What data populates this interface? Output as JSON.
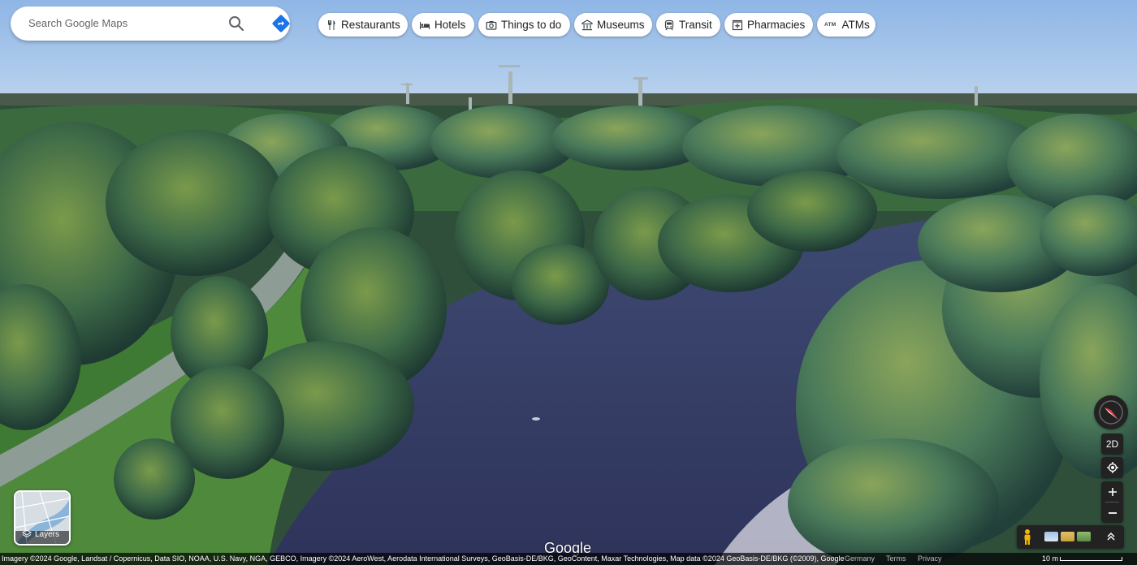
{
  "search": {
    "placeholder": "Search Google Maps"
  },
  "chips": [
    {
      "label": "Restaurants",
      "icon": "restaurant-icon"
    },
    {
      "label": "Hotels",
      "icon": "hotel-icon"
    },
    {
      "label": "Things to do",
      "icon": "camera-icon"
    },
    {
      "label": "Museums",
      "icon": "museum-icon"
    },
    {
      "label": "Transit",
      "icon": "transit-icon"
    },
    {
      "label": "Pharmacies",
      "icon": "pharmacy-icon"
    },
    {
      "label": "ATMs",
      "icon": "atm-icon"
    }
  ],
  "atm_glyph": "ATM",
  "layers": {
    "label": "Layers"
  },
  "controls": {
    "view_toggle": "2D"
  },
  "logo": "Google",
  "footer": {
    "attribution": "Imagery ©2024 Google, Landsat / Copernicus, Data SIO, NOAA, U.S. Navy, NGA, GEBCO, Imagery ©2024 AeroWest, Aerodata International Surveys, GeoBasis-DE/BKG, GeoContent, Maxar Technologies, Map data ©2024 GeoBasis-DE/BKG (©2009), Google",
    "country": "Germany",
    "terms": "Terms",
    "privacy": "Privacy",
    "scale": "10 m"
  },
  "colors": {
    "accent": "#1a73e8",
    "control_bg": "#222222",
    "compass_red": "#e53935"
  }
}
